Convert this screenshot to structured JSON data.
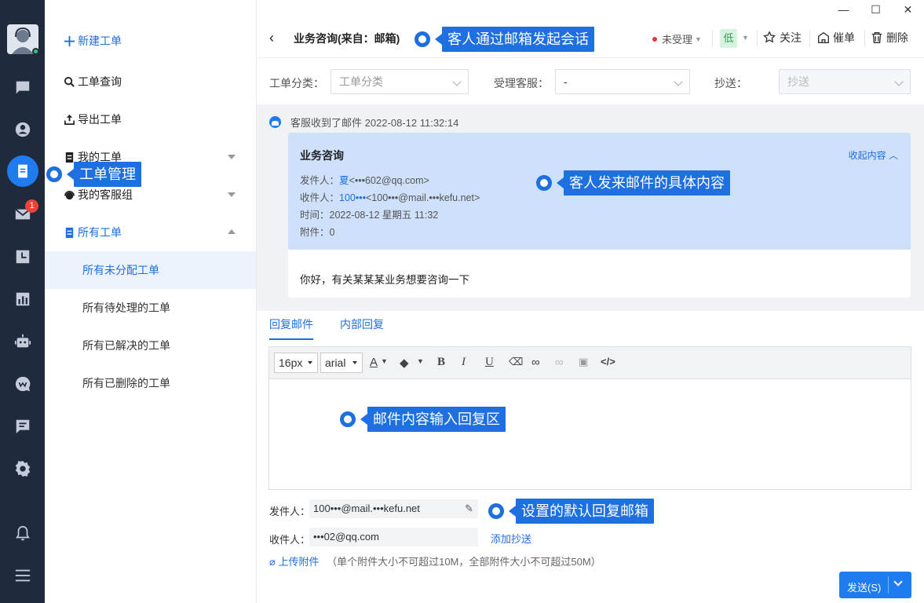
{
  "window": {
    "minimize": "—",
    "maximize": "☐",
    "close": "✕"
  },
  "sidebar": {
    "new_ticket": "新建工单",
    "ticket_query": "工单查询",
    "export_tickets": "导出工单",
    "my_tickets": "我的工单",
    "my_group": "我的客服组",
    "all_tickets": "所有工单",
    "sub_items": [
      "所有未分配工单",
      "所有待处理的工单",
      "所有已解决的工单",
      "所有已删除的工单"
    ],
    "mail_badge": "1"
  },
  "header": {
    "title": "业务咨询(来自：邮箱)",
    "status": "未受理",
    "priority": "低",
    "follow": "关注",
    "urge": "催单",
    "delete": "删除"
  },
  "filters": {
    "category_label": "工单分类：",
    "category_value": "工单分类",
    "assignee_label": "受理客服：",
    "assignee_value": "-",
    "cc_label": "抄送：",
    "cc_value": "抄送"
  },
  "conversation": {
    "received": "客服收到了邮件 2022-08-12 11:32:14",
    "mail_title": "业务咨询",
    "collapse": "收起内容",
    "sender_label": "发件人：",
    "sender_name": "夏",
    "sender_email": "<•••602@qq.com>",
    "recipient_label": "收件人：",
    "recipient_name": "100•••",
    "recipient_email": "<100•••@mail.•••kefu.net>",
    "time": "时间：2022-08-12 星期五 11:32",
    "attachments": "附件：0",
    "body": "你好，有关某某某业务想要咨询一下"
  },
  "reply": {
    "tab_reply_mail": "回复邮件",
    "tab_internal": "内部回复",
    "font_size": "16px",
    "font_family": "arial",
    "from_label": "发件人：",
    "from_value": "100•••@mail.•••kefu.net",
    "to_label": "收件人：",
    "to_value": "•••02@qq.com",
    "add_cc": "添加抄送",
    "upload": "上传附件",
    "upload_hint": "（单个附件大小不可超过10M，全部附件大小不可超过50M）",
    "send": "发送(S)"
  },
  "callouts": {
    "ticket_mgmt": "工单管理",
    "mail_session": "客人通过邮箱发起会话",
    "mail_content": "客人发来邮件的具体内容",
    "reply_area": "邮件内容输入回复区",
    "default_mailbox": "设置的默认回复邮箱"
  },
  "colors": {
    "accent": "#1e6fe0",
    "rail": "#1f2a3d",
    "mail_header": "#cfe0fb"
  }
}
